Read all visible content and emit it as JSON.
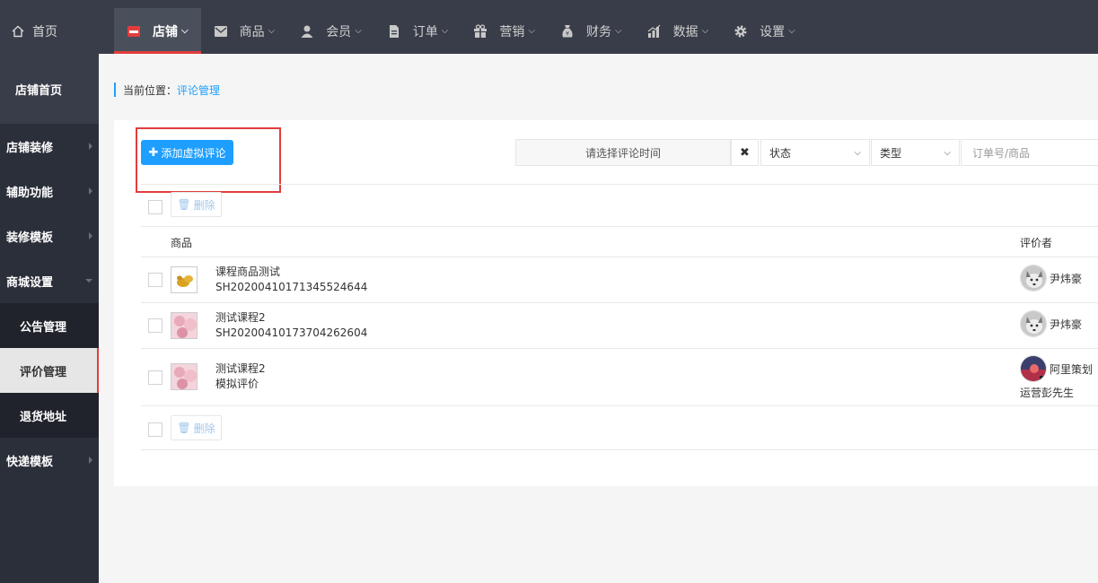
{
  "nav": {
    "home": "首页",
    "items": [
      {
        "label": "店铺",
        "icon": "store-icon"
      },
      {
        "label": "商品",
        "icon": "envelope-icon"
      },
      {
        "label": "会员",
        "icon": "user-icon"
      },
      {
        "label": "订单",
        "icon": "document-icon"
      },
      {
        "label": "营销",
        "icon": "gift-icon"
      },
      {
        "label": "财务",
        "icon": "money-bag-icon"
      },
      {
        "label": "数据",
        "icon": "bar-chart-icon"
      },
      {
        "label": "设置",
        "icon": "gear-icon"
      }
    ]
  },
  "sidebar": {
    "head": "店铺首页",
    "items": [
      {
        "label": "店铺装修"
      },
      {
        "label": "辅助功能"
      },
      {
        "label": "装修模板"
      },
      {
        "label": "商城设置"
      },
      {
        "label": "公告管理"
      },
      {
        "label": "评价管理"
      },
      {
        "label": "退货地址"
      },
      {
        "label": "快递模板"
      }
    ]
  },
  "breadcrumb": {
    "prefix": "当前位置：",
    "current": "评论管理"
  },
  "toolbar": {
    "add_label": "添加虚拟评论",
    "date_placeholder": "请选择评论时间",
    "clear_glyph": "✖",
    "status_label": "状态",
    "type_label": "类型",
    "search_placeholder": "订单号/商品",
    "delete_label": "删除"
  },
  "table": {
    "headers": {
      "product": "商品",
      "reviewer": "评价者"
    },
    "rows": [
      {
        "name": "课程商品测试",
        "sub": "SH20200410171345524644",
        "reviewer": "尹炜豪",
        "reviewer_line2": ""
      },
      {
        "name": "测试课程2",
        "sub": "SH20200410173704262604",
        "reviewer": "尹炜豪",
        "reviewer_line2": ""
      },
      {
        "name": "测试课程2",
        "sub": "模拟评价",
        "reviewer": "阿里策划",
        "reviewer_line2": "运营彭先生"
      }
    ]
  },
  "colors": {
    "accent": "#1e9fff",
    "active_red": "#e23d3d",
    "topbar": "#393d49"
  }
}
